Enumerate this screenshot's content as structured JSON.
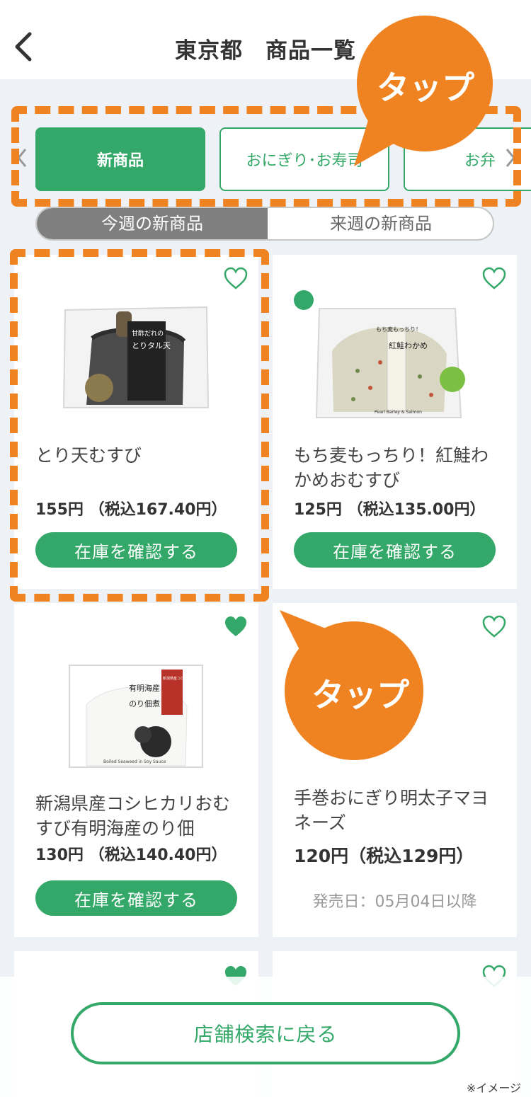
{
  "header": {
    "title": "東京都　商品一覧"
  },
  "categories": [
    {
      "label": "新商品",
      "active": true
    },
    {
      "label": "おにぎり･お寿司",
      "active": false
    },
    {
      "label": "お弁",
      "active": false
    }
  ],
  "week_toggle": {
    "this_week": "今週の新商品",
    "next_week": "来週の新商品"
  },
  "products": [
    {
      "name": "とり天むすび",
      "price": "155円 （税込167.40円）",
      "button": "在庫を確認する",
      "favorited": false,
      "package_text": [
        "甘酢だれの",
        "とりタル天"
      ]
    },
    {
      "name": "もち麦もっちり！紅鮭わかめおむすび",
      "price": "125円 （税込135.00円）",
      "button": "在庫を確認する",
      "favorited": false,
      "package_text": [
        "もち麦もっちり！",
        "紅鮭わかめ",
        "Pearl Barley & Salmon"
      ]
    },
    {
      "name": "新潟県産コシヒカリおむすび有明海産のり佃",
      "price": "130円 （税込140.40円）",
      "button": "在庫を確認する",
      "favorited": true,
      "package_text": [
        "有明海産",
        "のり佃煮",
        "新潟県産コシヒカリ使用",
        "Boiled Seaweed in Soy Sauce"
      ]
    },
    {
      "name": "手巻おにぎり明太子マヨネーズ",
      "price": "120円（税込129円）",
      "release": "発売日：05月04日以降",
      "favorited": false
    }
  ],
  "bottom": {
    "back_button": "店舗検索に戻る",
    "note": "※イメージ"
  },
  "overlays": {
    "tap_label_1": "タップ",
    "tap_label_2": "タップ"
  },
  "colors": {
    "accent": "#34a868",
    "highlight": "#f08321",
    "background": "#eef1f5"
  }
}
